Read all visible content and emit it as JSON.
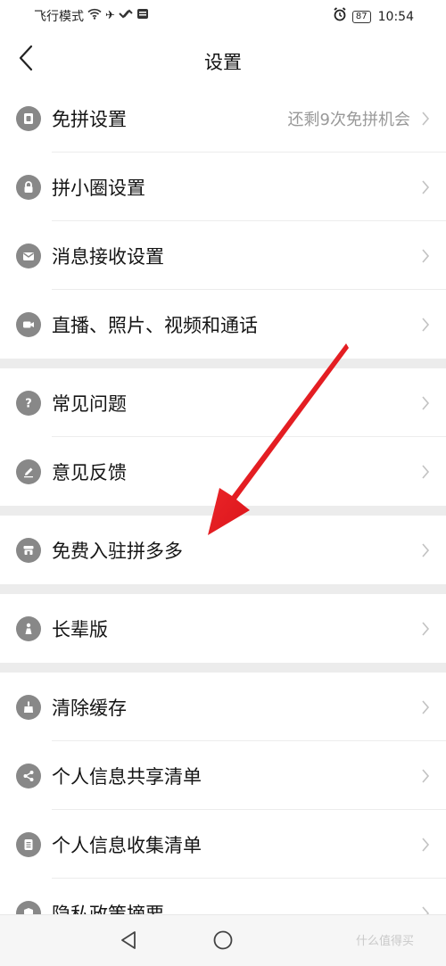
{
  "status": {
    "left_text": "飞行模式",
    "battery": "87",
    "time": "10:54"
  },
  "nav": {
    "title": "设置"
  },
  "settings": {
    "groups": [
      [
        {
          "label": "免拼设置",
          "value": "还剩9次免拼机会",
          "icon": "coupon-icon"
        },
        {
          "label": "拼小圈设置",
          "icon": "lock-icon"
        },
        {
          "label": "消息接收设置",
          "icon": "mail-icon"
        },
        {
          "label": "直播、照片、视频和通话",
          "icon": "video-icon"
        }
      ],
      [
        {
          "label": "常见问题",
          "icon": "question-icon"
        },
        {
          "label": "意见反馈",
          "icon": "pencil-icon"
        }
      ],
      [
        {
          "label": "免费入驻拼多多",
          "icon": "store-icon"
        }
      ],
      [
        {
          "label": "长辈版",
          "icon": "elder-icon"
        }
      ],
      [
        {
          "label": "清除缓存",
          "icon": "broom-icon"
        },
        {
          "label": "个人信息共享清单",
          "icon": "share-icon"
        },
        {
          "label": "个人信息收集清单",
          "icon": "list-icon"
        },
        {
          "label": "隐私政策摘要",
          "icon": "privacy-icon"
        }
      ]
    ]
  },
  "bottom_nav": {
    "watermark": "什么值得买"
  },
  "colors": {
    "icon_gray": "#888888",
    "separator": "#ececec",
    "arrow_red": "#e8141e"
  }
}
